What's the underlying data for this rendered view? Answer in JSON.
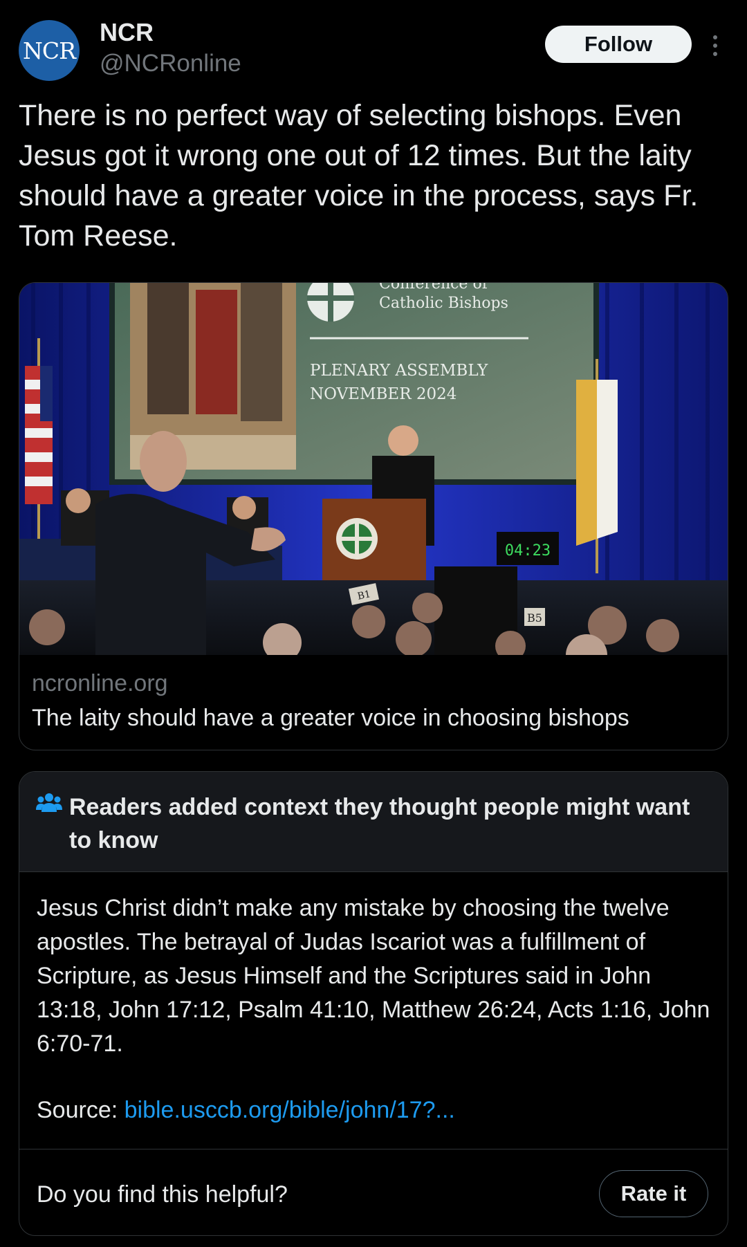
{
  "author": {
    "avatar_text": "NCR",
    "display_name": "NCR",
    "handle": "@NCRonline"
  },
  "actions": {
    "follow_label": "Follow",
    "more_icon": "more-vertical-icon"
  },
  "post": {
    "text": "There is no perfect way of selecting bishops. Even Jesus got it wrong one out of 12 times. But the laity should have a greater voice in the process, says Fr. Tom Reese."
  },
  "link_card": {
    "image_text": {
      "conference_top": "Conference of",
      "conference": "Catholic Bishops",
      "assembly": "PLENARY ASSEMBLY",
      "date": "NOVEMBER 2024",
      "timer": "04:23",
      "table_tag": "B5",
      "table_tag2": "B1"
    },
    "domain": "ncronline.org",
    "title": "The laity should have a greater voice in choosing bishops"
  },
  "community_note": {
    "icon": "people-icon",
    "title": "Readers added context they thought people might want to know",
    "body": "Jesus Christ didn’t make any mistake by choosing the twelve apostles. The betrayal of Judas Iscariot was a fulfillment of Scripture, as Jesus Himself and the Scriptures said in John 13:18, John 17:12, Psalm 41:10, Matthew 26:24, Acts 1:16, John 6:70-71.",
    "source_label": "Source:",
    "source_link": "bible.usccb.org/bible/john/17?...",
    "helpful_question": "Do you find this helpful?",
    "rate_label": "Rate it"
  },
  "colors": {
    "background": "#000000",
    "text": "#e7e9ea",
    "secondary": "#71767b",
    "link": "#1d9bf0",
    "border": "#2f3336",
    "avatar": "#1d5fa6",
    "timer_green": "#3ddc5f"
  }
}
